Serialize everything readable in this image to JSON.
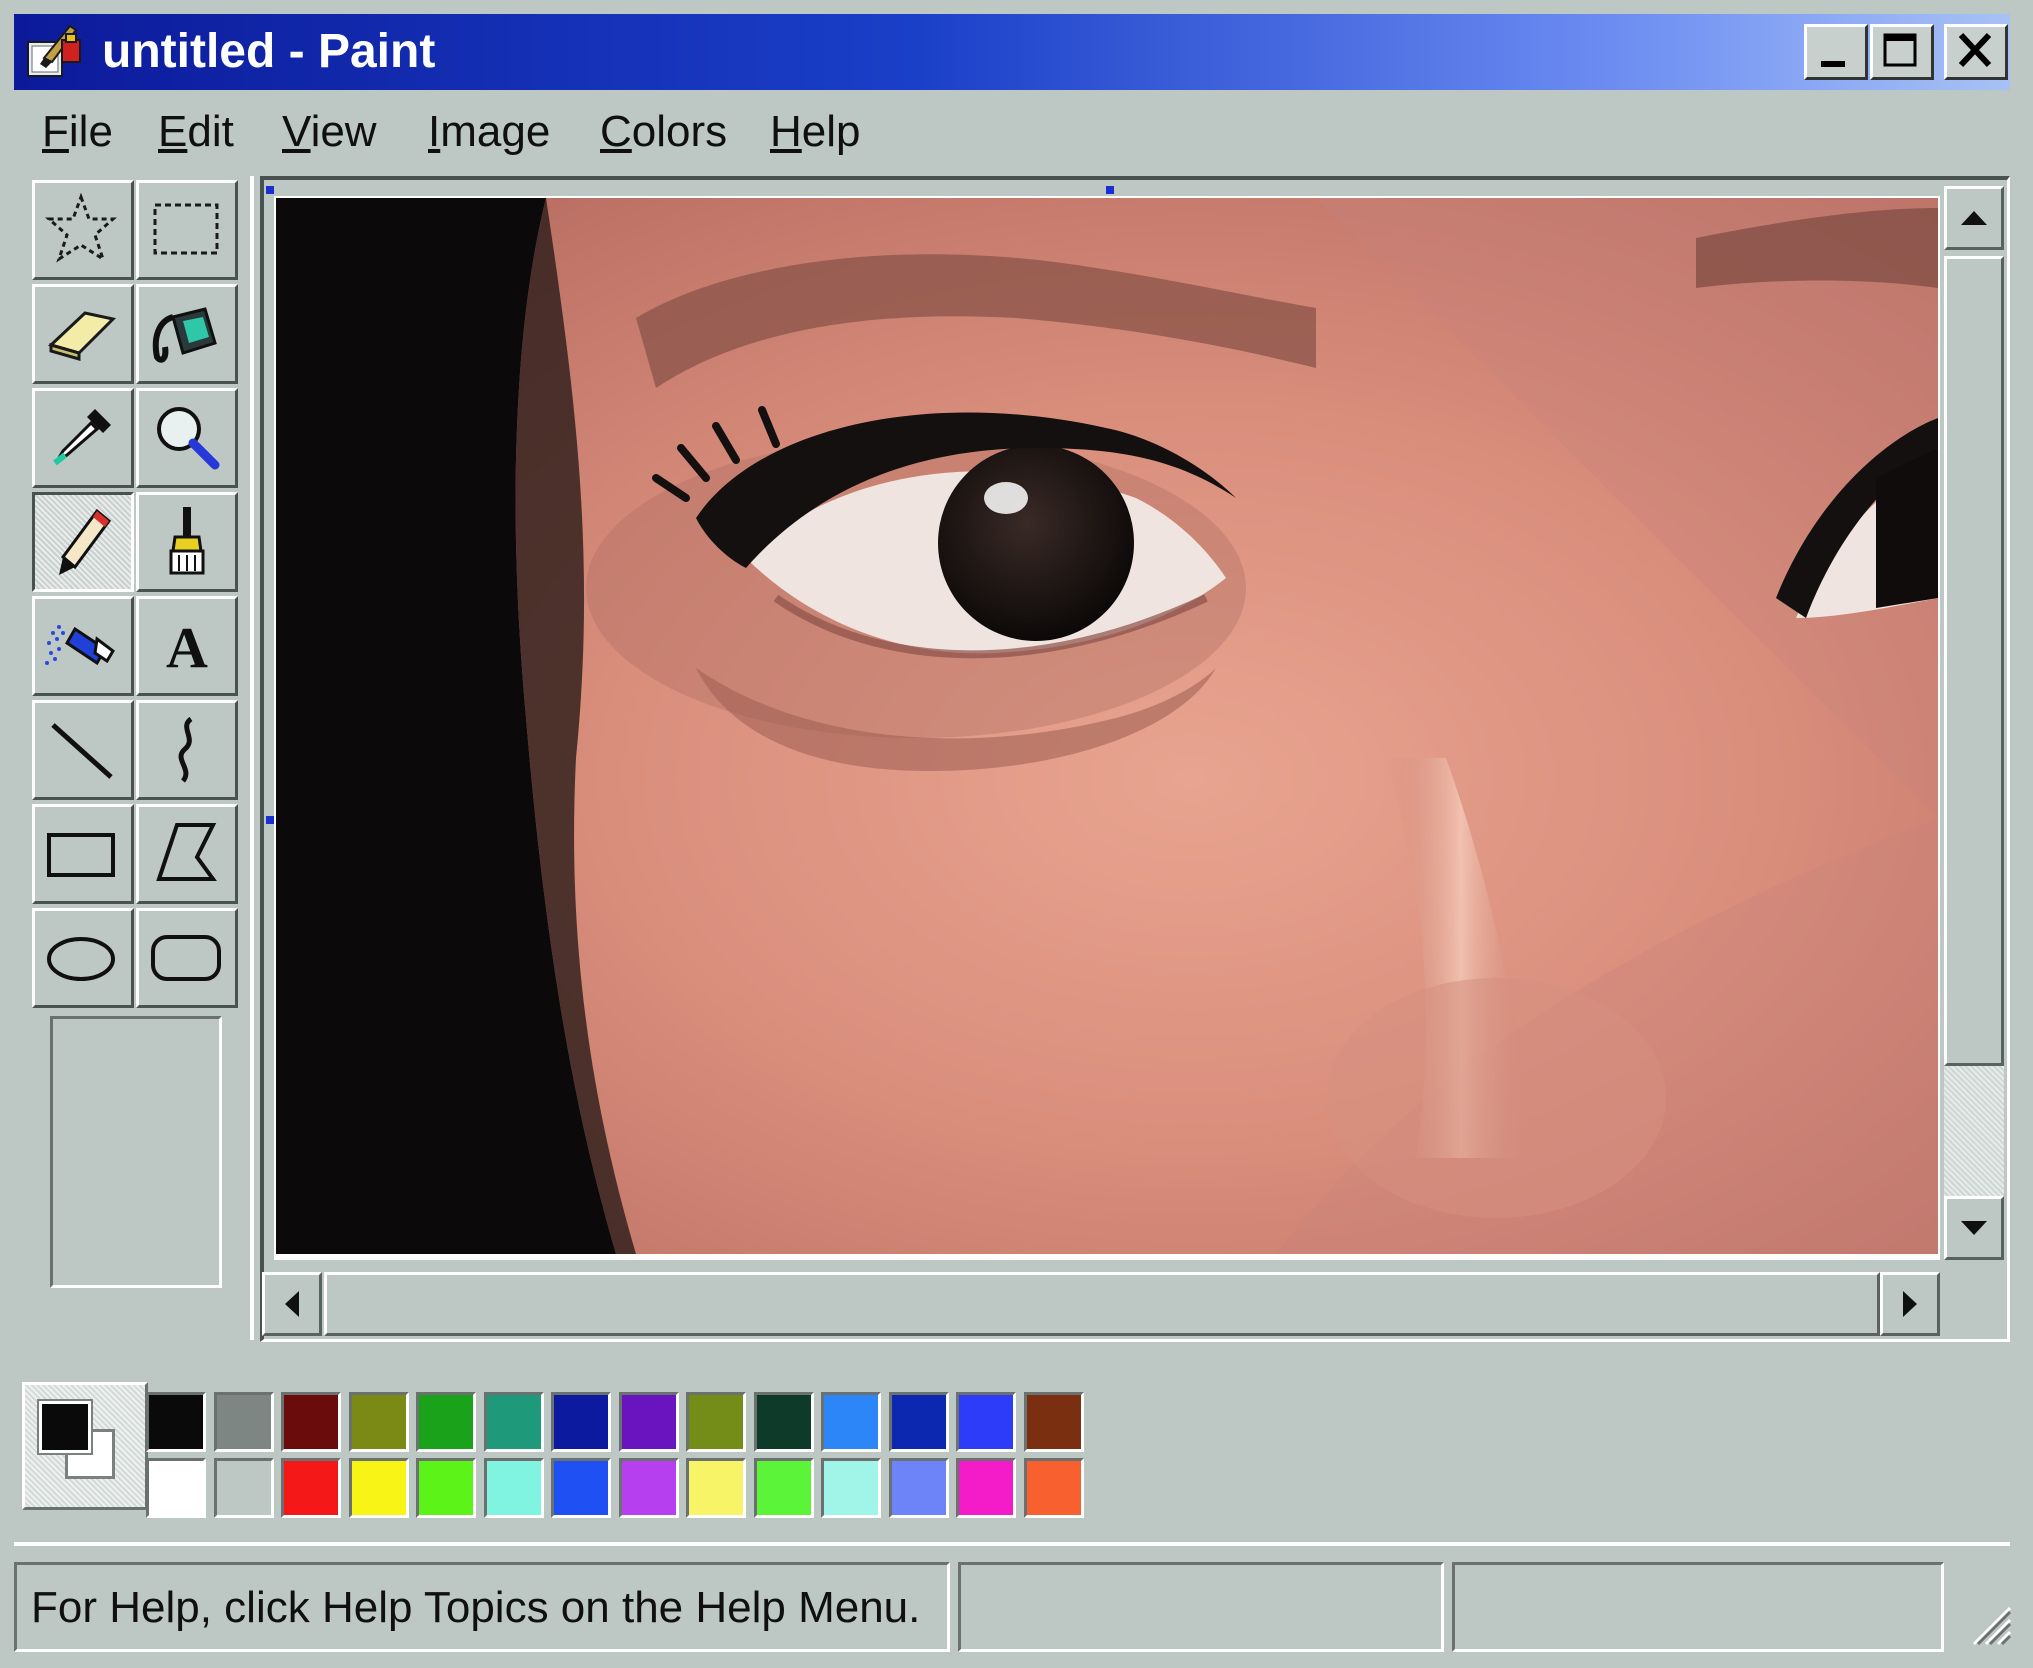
{
  "window": {
    "title": "untitled - Paint",
    "buttons": [
      "minimize",
      "maximize",
      "close"
    ]
  },
  "menu": {
    "items": [
      {
        "label": "File"
      },
      {
        "label": "Edit"
      },
      {
        "label": "View"
      },
      {
        "label": "Image"
      },
      {
        "label": "Colors"
      },
      {
        "label": "Help"
      }
    ]
  },
  "toolbox": {
    "tools": [
      {
        "name": "free-form-select",
        "icon": "free-form-select-icon"
      },
      {
        "name": "select",
        "icon": "rect-select-icon"
      },
      {
        "name": "eraser",
        "icon": "eraser-icon"
      },
      {
        "name": "fill-with-color",
        "icon": "paint-bucket-icon"
      },
      {
        "name": "pick-color",
        "icon": "eyedropper-icon"
      },
      {
        "name": "magnifier",
        "icon": "magnifier-icon"
      },
      {
        "name": "pencil",
        "icon": "pencil-icon",
        "active": true
      },
      {
        "name": "brush",
        "icon": "brush-icon"
      },
      {
        "name": "airbrush",
        "icon": "airbrush-icon"
      },
      {
        "name": "text",
        "icon": "text-icon"
      },
      {
        "name": "line",
        "icon": "line-icon"
      },
      {
        "name": "curve",
        "icon": "curve-icon"
      },
      {
        "name": "rectangle",
        "icon": "rectangle-icon"
      },
      {
        "name": "polygon",
        "icon": "polygon-icon"
      },
      {
        "name": "ellipse",
        "icon": "ellipse-icon"
      },
      {
        "name": "rounded-rectangle",
        "icon": "rounded-rectangle-icon"
      }
    ],
    "text_tool_glyph": "A"
  },
  "canvas": {
    "content": "photo-closeup-eye"
  },
  "colors": {
    "foreground": "#0a0a0a",
    "background": "#ffffff",
    "palette_top": [
      "#0a0a0a",
      "#7e8683",
      "#6b0c0c",
      "#7a8a14",
      "#1aa31a",
      "#1e9a7a",
      "#0c1aa0",
      "#6a14c0",
      "#748c18",
      "#0e3a2a",
      "#2c86f8",
      "#0c28b0",
      "#2c3cf8",
      "#7a3010"
    ],
    "palette_bottom": [
      "#ffffff",
      "#bdc8c4",
      "#f41818",
      "#f8f416",
      "#5cf418",
      "#80f4e0",
      "#1e50f4",
      "#b640f0",
      "#f8f468",
      "#5cf438",
      "#a0f4e8",
      "#6c84f8",
      "#f41cc8",
      "#f86030"
    ]
  },
  "status": {
    "help_text": "For Help, click Help Topics on the Help Menu.",
    "pane2": "",
    "pane3": ""
  }
}
